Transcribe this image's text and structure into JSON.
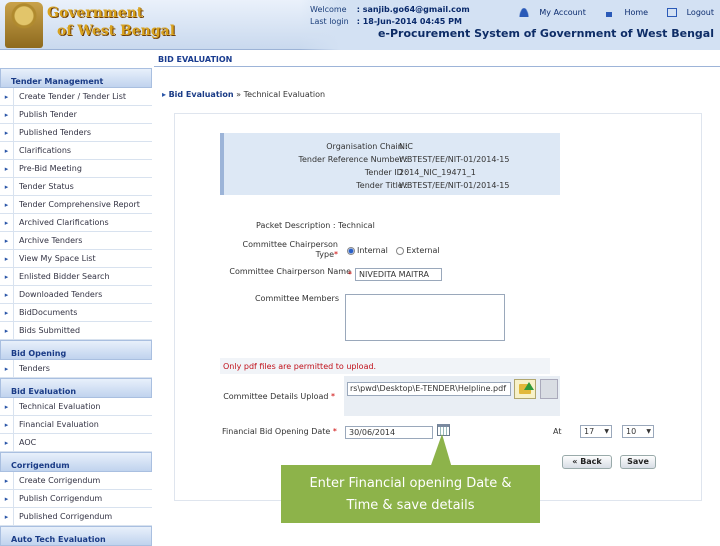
{
  "header": {
    "gov_line1": "Government",
    "gov_line2": "of West Bengal",
    "welcome_label": "Welcome",
    "welcome_value": ": sanjib.go64@gmail.com",
    "lastlogin_label": "Last login",
    "lastlogin_value": ": 18-Jun-2014 04:45 PM",
    "my_account": "My Account",
    "home": "Home",
    "logout": "Logout",
    "system_title": "e-Procurement System of Government of West Bengal"
  },
  "page_heading": "BID EVALUATION",
  "breadcrumb": {
    "first": "Bid Evaluation",
    "sep": "»",
    "second": "Technical Evaluation"
  },
  "sidebar": {
    "tender_mgmt": "Tender Management",
    "tm_items": [
      "Create Tender / Tender List",
      "Publish Tender",
      "Published Tenders",
      "Clarifications",
      "Pre-Bid Meeting",
      "Tender Status",
      "Tender Comprehensive Report",
      "Archived Clarifications",
      "Archive Tenders",
      "View My Space List",
      "Enlisted Bidder Search",
      "Downloaded Tenders",
      "BidDocuments",
      "Bids Submitted"
    ],
    "bid_opening": "Bid Opening",
    "bo_items": [
      "Tenders"
    ],
    "bid_eval": "Bid Evaluation",
    "be_items": [
      "Technical Evaluation",
      "Financial Evaluation",
      "AOC"
    ],
    "corrigendum": "Corrigendum",
    "co_items": [
      "Create Corrigendum",
      "Publish Corrigendum",
      "Published Corrigendum"
    ],
    "auto_tech": "Auto Tech Evaluation"
  },
  "info": {
    "org_label": "Organisation Chain :",
    "org_value": "NIC",
    "ref_label": "Tender Reference Number :",
    "ref_value": "WBTEST/EE/NIT-01/2014-15",
    "id_label": "Tender ID :",
    "id_value": "2014_NIC_19471_1",
    "title_label": "Tender Title :",
    "title_value": "WBTEST/EE/NIT-01/2014-15"
  },
  "form": {
    "packet_label": "Packet Description :",
    "packet_value": "Technical",
    "chair_type_label1": "Committee Chairperson",
    "chair_type_label2": "Type",
    "internal": "Internal",
    "external": "External",
    "chair_name_label": "Committee Chairperson Name",
    "chair_name_value": "NIVEDITA MAITRA",
    "members_label": "Committee Members",
    "warn_text": "Only pdf files are permitted to upload.",
    "upload_label": "Committee Details Upload",
    "upload_path": "rs\\pwd\\Desktop\\E-TENDER\\Helpline.pdf",
    "fin_date_label": "Financial Bid Opening Date",
    "fin_date_value": "30/06/2014",
    "at_label": "At",
    "hour_value": "17",
    "min_value": "10",
    "back_label": "« Back",
    "save_label": "Save"
  },
  "callout": {
    "line1": "Enter Financial opening Date &",
    "line2": "Time & save details"
  },
  "colors": {
    "callout": "#8db34a",
    "brand_blue": "#1a3b86",
    "warn": "#c0101a"
  }
}
